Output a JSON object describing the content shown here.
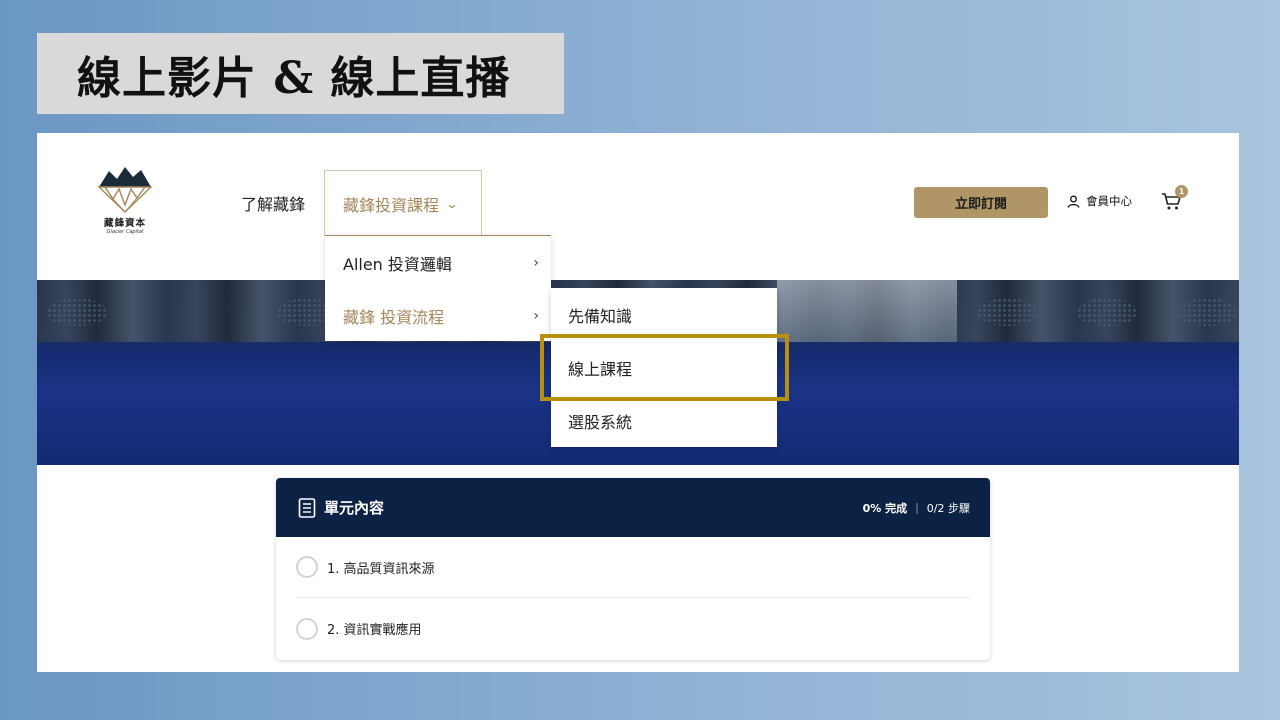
{
  "slide": {
    "title": "線上影片 & 線上直播"
  },
  "header": {
    "logo": {
      "text": "藏鋒資本",
      "subtitle": "Glacier Capital"
    },
    "nav": [
      {
        "label": "了解藏鋒"
      },
      {
        "label": "藏鋒投資課程",
        "icon": "chevron-down-icon"
      }
    ],
    "subscribe_label": "立即訂閱",
    "member_label": "會員中心",
    "cart_count": "1"
  },
  "dropdown": {
    "items": [
      {
        "label": "Allen 投資邏輯"
      },
      {
        "label": "藏鋒 投資流程"
      }
    ],
    "submenu": [
      {
        "label": "先備知識"
      },
      {
        "label": "線上課程"
      },
      {
        "label": "選股系統"
      }
    ]
  },
  "unit": {
    "title": "單元內容",
    "progress": "0% 完成",
    "steps": "0/2 步驟",
    "lessons": [
      {
        "label": "1. 高品質資訊來源"
      },
      {
        "label": "2. 資訊實戰應用"
      }
    ]
  },
  "colors": {
    "accent_gold": "#b09667",
    "highlight_border": "#b8900f",
    "header_navy": "#0c2244"
  }
}
